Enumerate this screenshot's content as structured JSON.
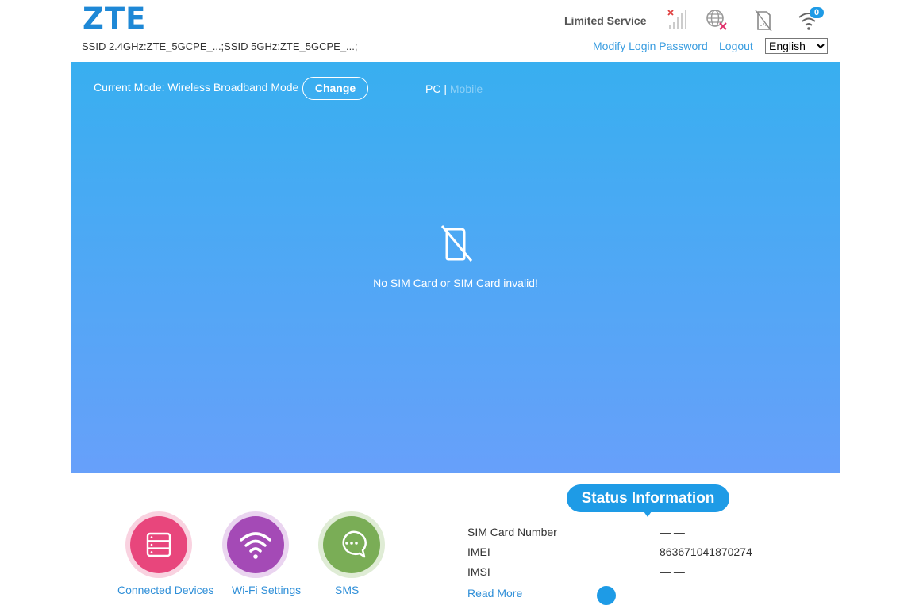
{
  "header": {
    "logo": "ZTE",
    "ssid_text": "SSID 2.4GHz:ZTE_5GCPE_...;SSID 5GHz:ZTE_5GCPE_...;",
    "service_status": "Limited Service",
    "icons": [
      "signal-none-icon",
      "network-disconnected-icon",
      "no-sim-icon",
      "wifi-icon"
    ],
    "wifi_clients_badge": "0",
    "modify_password_label": "Modify Login Password",
    "logout_label": "Logout",
    "language_selected": "English"
  },
  "banner": {
    "mode_text": "Current Mode: Wireless Broadband Mode",
    "change_label": "Change",
    "pc_label": "PC",
    "separator": "|",
    "mobile_label": "Mobile",
    "sim_message": "No SIM Card or SIM Card invalid!"
  },
  "quick_links": [
    {
      "label": "Connected Devices",
      "color": "#e8467c",
      "ring": "#f9d2e0",
      "icon": "devices-icon"
    },
    {
      "label": "Wi-Fi Settings",
      "color": "#a44ab6",
      "ring": "#ead4f0",
      "icon": "wifi-icon"
    },
    {
      "label": "SMS",
      "color": "#7aad56",
      "ring": "#dfecd5",
      "icon": "chat-icon"
    }
  ],
  "status": {
    "title": "Status Information",
    "rows": [
      {
        "label": "SIM Card Number",
        "value": "— —"
      },
      {
        "label": "IMEI",
        "value": "863671041870274"
      },
      {
        "label": "IMSI",
        "value": "— —"
      }
    ],
    "partial_link": "Read More"
  }
}
